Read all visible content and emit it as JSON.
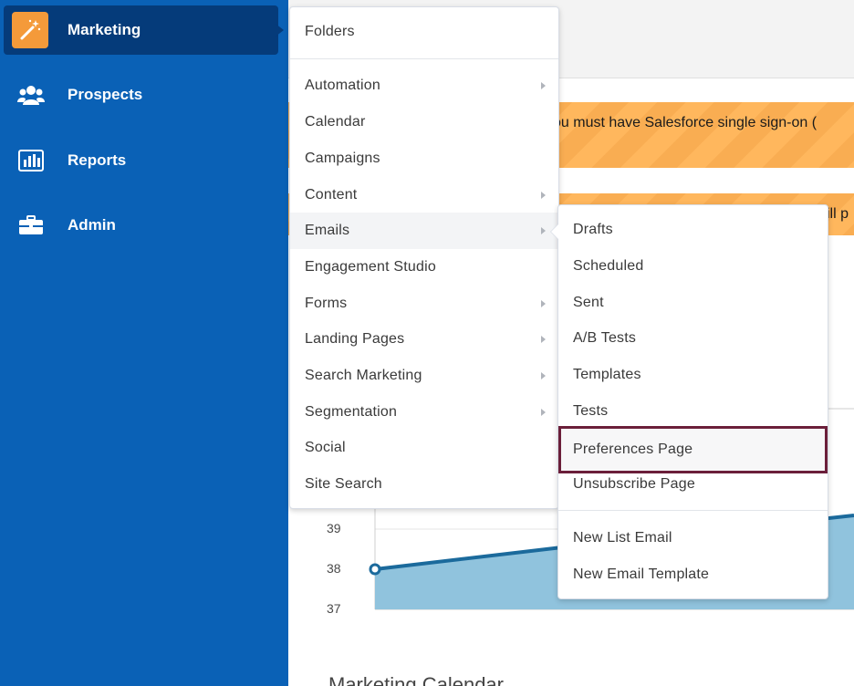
{
  "colors": {
    "sidebar_bg": "#0a61b6",
    "sidebar_active_bg": "#053b7a",
    "brand_icon_bg": "#f49a3a",
    "banner_bg": "#ffb75d",
    "selected_outline": "#6b1f3a",
    "chart_line": "#1b6a9c",
    "chart_fill": "#90c3dd"
  },
  "sidebar": {
    "items": [
      {
        "label": "Marketing",
        "icon": "magic-wand-icon",
        "active": true
      },
      {
        "label": "Prospects",
        "icon": "people-icon",
        "active": false
      },
      {
        "label": "Reports",
        "icon": "bar-chart-icon",
        "active": false
      },
      {
        "label": "Admin",
        "icon": "briefcase-icon",
        "active": false
      }
    ]
  },
  "main": {
    "banners": [
      {
        "text": "ou must have Salesforce single sign-on ("
      },
      {
        "text": "ill p"
      }
    ],
    "chart": {
      "y_ticks": [
        "39",
        "38",
        "37"
      ]
    },
    "section_title": "Marketing Calendar"
  },
  "marketing_menu": {
    "header": "Folders",
    "items": [
      {
        "label": "Automation",
        "has_submenu": true
      },
      {
        "label": "Calendar",
        "has_submenu": false
      },
      {
        "label": "Campaigns",
        "has_submenu": false
      },
      {
        "label": "Content",
        "has_submenu": true
      },
      {
        "label": "Emails",
        "has_submenu": true
      },
      {
        "label": "Engagement Studio",
        "has_submenu": false
      },
      {
        "label": "Forms",
        "has_submenu": true
      },
      {
        "label": "Landing Pages",
        "has_submenu": true
      },
      {
        "label": "Search Marketing",
        "has_submenu": true
      },
      {
        "label": "Segmentation",
        "has_submenu": true
      },
      {
        "label": "Social",
        "has_submenu": false
      },
      {
        "label": "Site Search",
        "has_submenu": false
      }
    ]
  },
  "emails_submenu": {
    "items": [
      {
        "label": "Drafts"
      },
      {
        "label": "Scheduled"
      },
      {
        "label": "Sent"
      },
      {
        "label": "A/B Tests"
      },
      {
        "label": "Templates"
      },
      {
        "label": "Tests"
      },
      {
        "label": "Preferences Page"
      },
      {
        "label": "Unsubscribe Page"
      }
    ],
    "actions": [
      {
        "label": "New List Email"
      },
      {
        "label": "New Email Template"
      }
    ]
  }
}
